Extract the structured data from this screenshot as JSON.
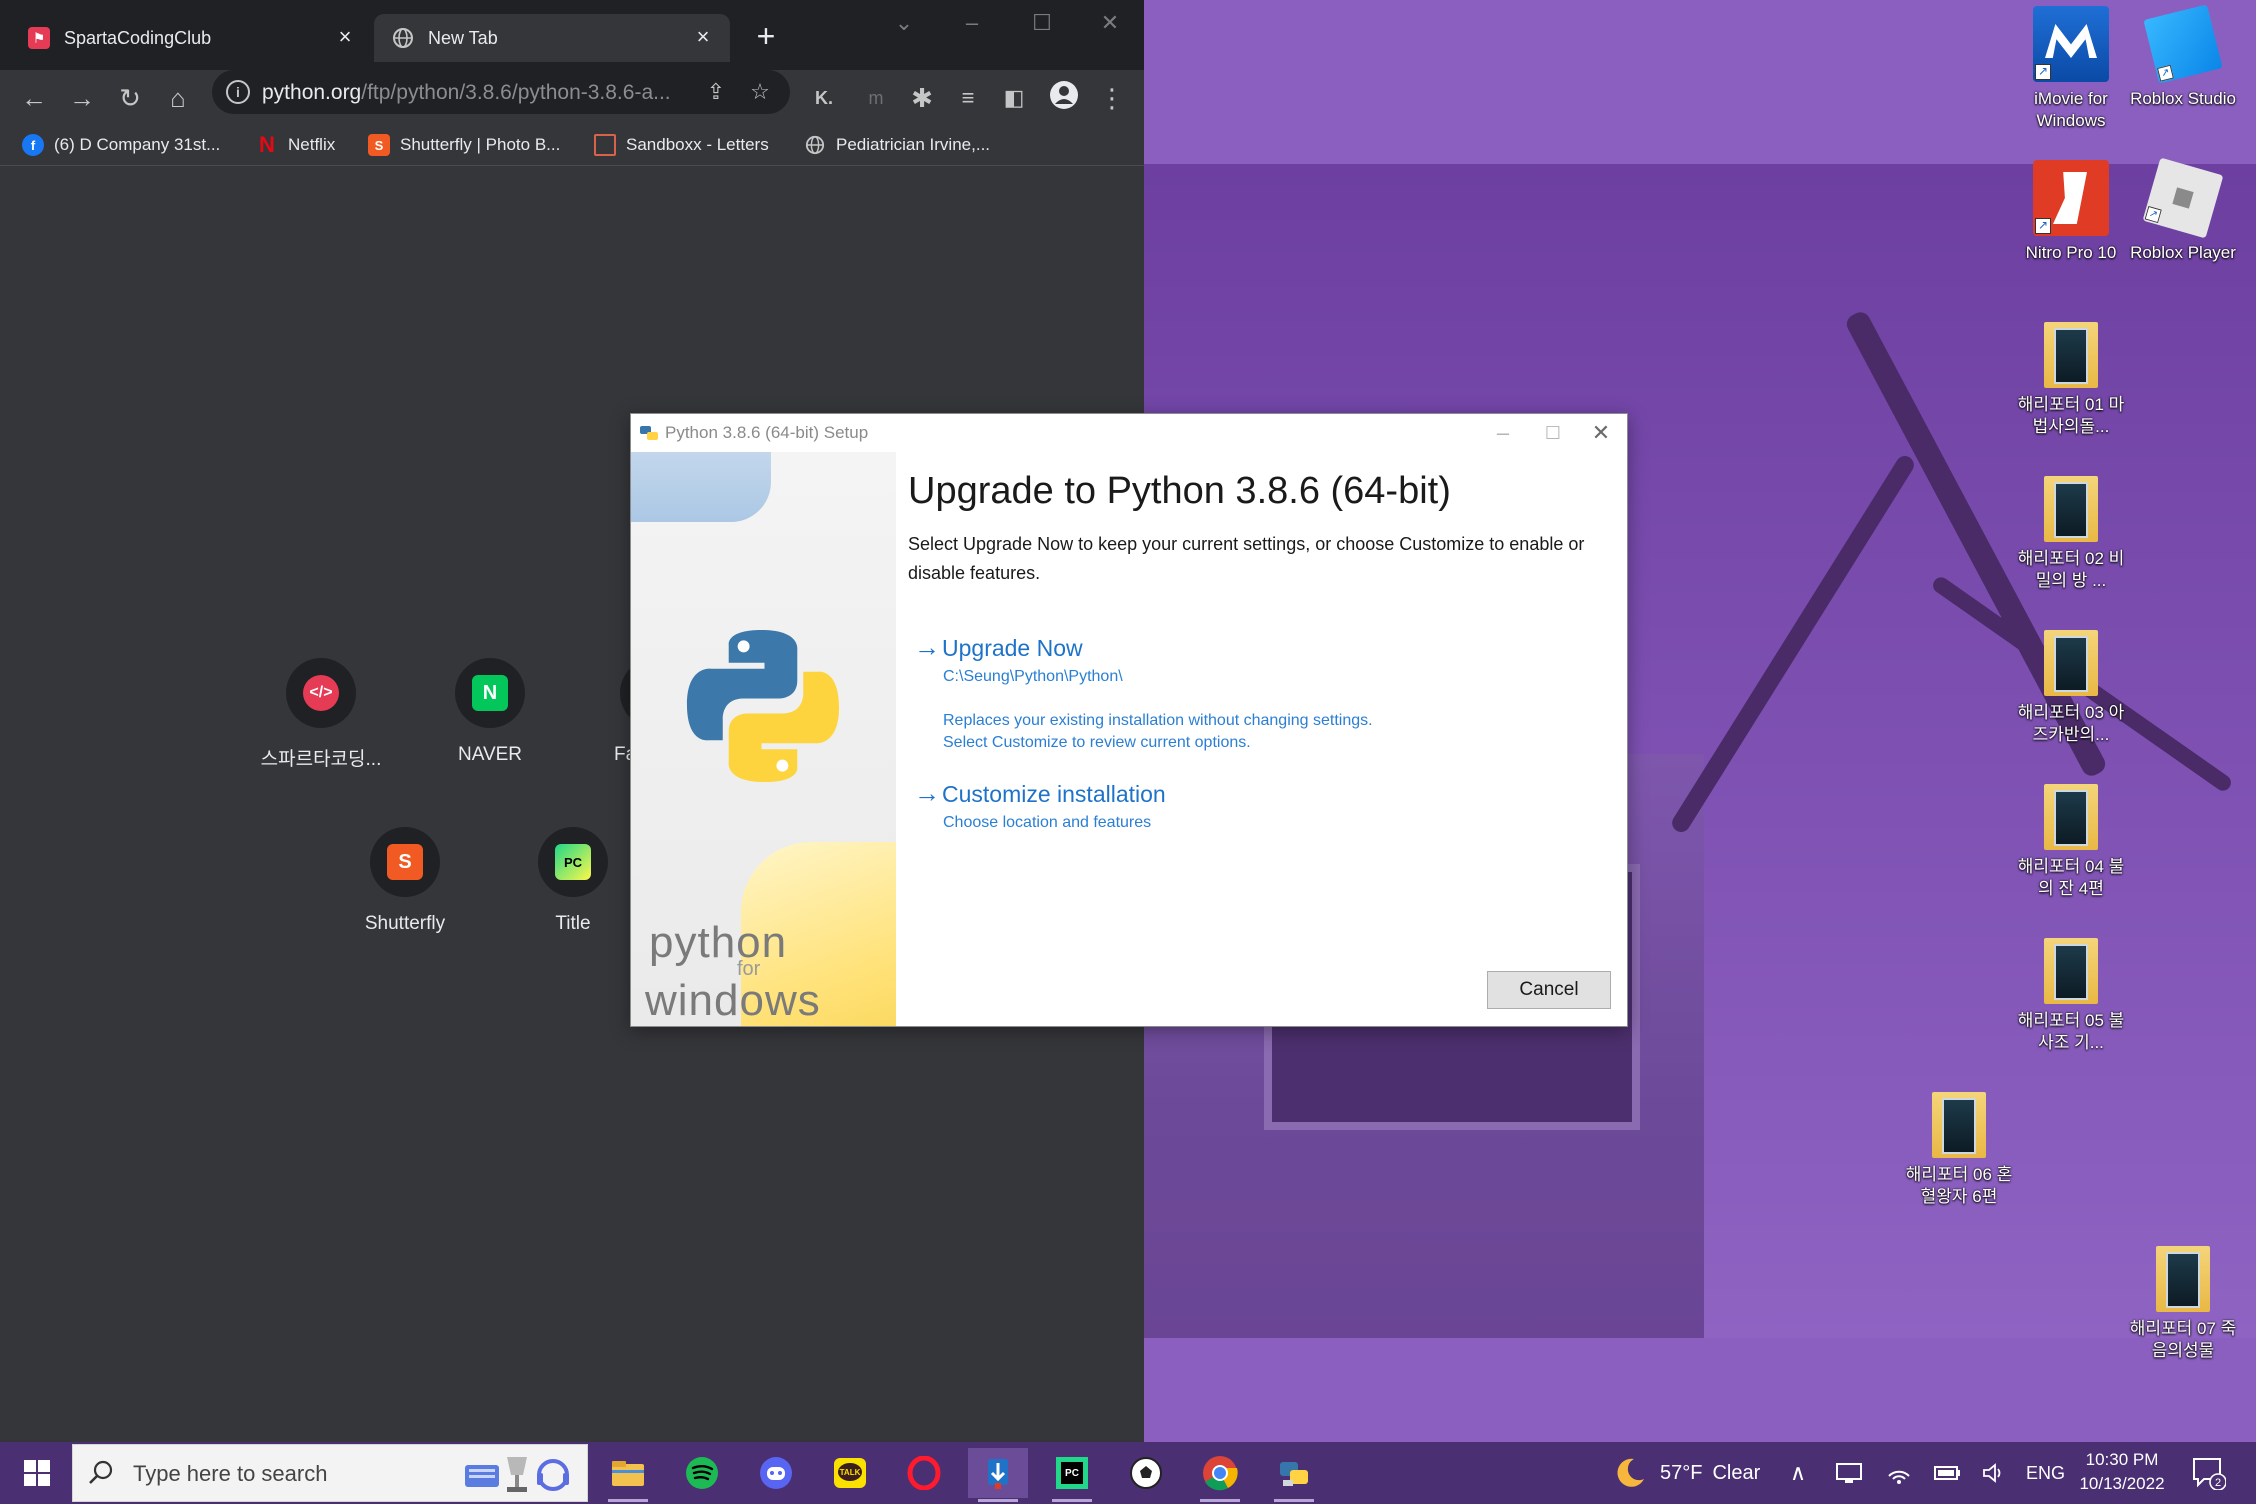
{
  "browser": {
    "tabs": [
      {
        "label": "SpartaCodingClub",
        "favicon": "sparta-icon",
        "active": false
      },
      {
        "label": "New Tab",
        "favicon": "globe-icon",
        "active": true
      }
    ],
    "new_tab_symbol": "+",
    "address": {
      "host": "python.org",
      "path": "/ftp/python/3.8.6/python-3.8.6-a..."
    },
    "extension_label": "K.",
    "bookmarks": [
      {
        "label": "(6) D Company 31st...",
        "icon": "facebook-icon",
        "color": "#1877f2"
      },
      {
        "label": "Netflix",
        "icon": "netflix-icon",
        "color": "#e50914"
      },
      {
        "label": "Shutterfly | Photo B...",
        "icon": "shutterfly-icon",
        "color": "#f15a22"
      },
      {
        "label": "Sandboxx - Letters",
        "icon": "sandboxx-icon",
        "color": "#d9634a"
      },
      {
        "label": "Pediatrician Irvine,...",
        "icon": "globe-icon",
        "color": "#c4c7c5"
      }
    ],
    "shortcuts": [
      {
        "label": "스파르타코딩...",
        "icon": "sparta-code-icon",
        "color": "#e63b55"
      },
      {
        "label": "NAVER",
        "icon": "naver-icon",
        "color": "#03c75a",
        "glyph": "N"
      },
      {
        "label": "Fa",
        "icon": "partial-shortcut-icon",
        "color": "#202124"
      },
      {
        "label": "Shutterfly",
        "icon": "shutterfly-icon",
        "color": "#f15a22",
        "glyph": "S"
      },
      {
        "label": "Title",
        "icon": "pycharm-icon",
        "color": "#21d789",
        "glyph": "PC"
      }
    ]
  },
  "dialog": {
    "title": "Python 3.8.6 (64-bit) Setup",
    "heading": "Upgrade to Python 3.8.6 (64-bit)",
    "description": "Select Upgrade Now to keep your current settings, or choose Customize to enable or disable features.",
    "side_brand": {
      "word1": "python",
      "word2": "for",
      "word3": "windows"
    },
    "upgrade": {
      "title": "Upgrade Now",
      "path": "C:\\Seung\\Python\\Python\\",
      "line1": "Replaces your existing installation without changing settings.",
      "line2": "Select Customize to review current options."
    },
    "customize": {
      "title": "Customize installation",
      "subtitle": "Choose location and features"
    },
    "cancel_label": "Cancel",
    "accent_color": "#1e73c9"
  },
  "desktop_icons": [
    {
      "label": "iMovie for Windows",
      "icon": "imovie-icon"
    },
    {
      "label": "Roblox Studio",
      "icon": "roblox-studio-icon"
    },
    {
      "label": "Nitro Pro 10",
      "icon": "nitro-pro-icon"
    },
    {
      "label": "Roblox Player",
      "icon": "roblox-player-icon"
    },
    {
      "label": "해리포터 01 마법사의돌...",
      "icon": "folder-icon"
    },
    {
      "label": "해리포터 02 비밀의 방 ...",
      "icon": "folder-icon"
    },
    {
      "label": "해리포터 03 아즈카반의...",
      "icon": "folder-icon"
    },
    {
      "label": "해리포터 04 불의 잔 4편",
      "icon": "folder-icon"
    },
    {
      "label": "해리포터 05 불사조 기...",
      "icon": "folder-icon"
    },
    {
      "label": "해리포터 06 혼혈왕자 6편",
      "icon": "folder-icon"
    },
    {
      "label": "해리포터 07 죽음의성물",
      "icon": "folder-icon"
    }
  ],
  "taskbar": {
    "search_placeholder": "Type here to search",
    "apps": [
      {
        "name": "file-explorer-icon",
        "color": "#f2c14e"
      },
      {
        "name": "spotify-icon",
        "color": "#1db954"
      },
      {
        "name": "discord-icon",
        "color": "#5865f2"
      },
      {
        "name": "kakaotalk-icon",
        "color": "#fae100"
      },
      {
        "name": "opera-icon",
        "color": "#ff1b2d"
      },
      {
        "name": "python-installer-pin-icon",
        "color": "#1e73c9"
      },
      {
        "name": "pycharm-icon",
        "color": "#21d789"
      },
      {
        "name": "soccer-icon",
        "color": "#ffffff"
      },
      {
        "name": "chrome-icon",
        "color": "#4285f4"
      },
      {
        "name": "python-setup-icon",
        "color": "#3776ab"
      }
    ],
    "weather": {
      "temp": "57°F",
      "condition": "Clear"
    },
    "language": "ENG",
    "time": "10:30 PM",
    "date": "10/13/2022",
    "notification_count": "2"
  }
}
